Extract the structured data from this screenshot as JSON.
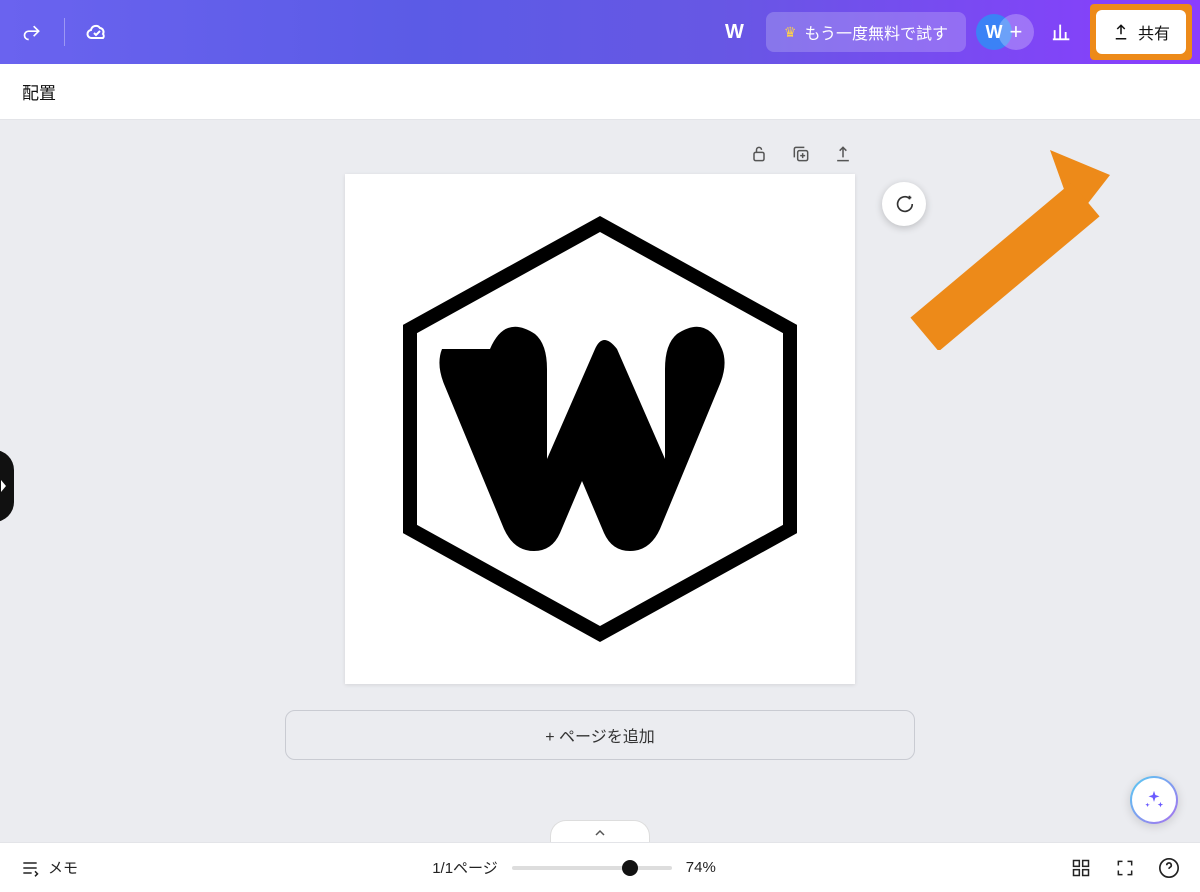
{
  "header": {
    "doc_title": "W",
    "try_again_label": "もう一度無料で試す",
    "avatar_letter": "W",
    "share_label": "共有"
  },
  "secondbar": {
    "position_label": "配置"
  },
  "canvas": {
    "add_page_label": "+ ページを追加"
  },
  "footer": {
    "memo_label": "メモ",
    "page_indicator": "1/1ページ",
    "zoom_label": "74%"
  }
}
